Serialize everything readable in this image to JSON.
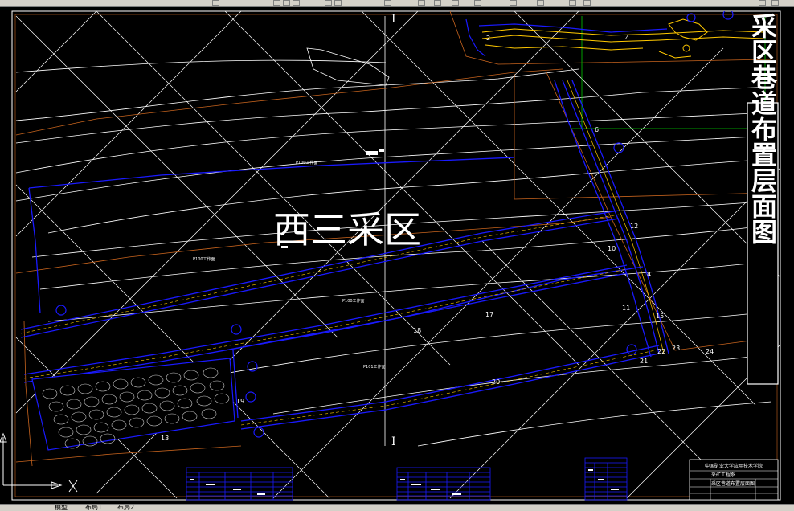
{
  "drawing": {
    "main_label": "西三采区",
    "vertical_title": "采区巷道布置层面图",
    "section_marks": [
      "I",
      "I"
    ],
    "workface_labels": [
      "P100工作面",
      "P100工作面",
      "P100工作面",
      "P101工作面"
    ],
    "point_labels": [
      "2",
      "4",
      "6",
      "10",
      "11",
      "12",
      "13",
      "14",
      "15",
      "17",
      "18",
      "19",
      "20",
      "21",
      "22",
      "23",
      "24"
    ]
  },
  "title_block": {
    "school": "中国矿业大学应用技术学院",
    "dept": "采矿工程系",
    "drawing_name": "采区巷道布置层面图"
  },
  "tabs": {
    "model": "模型",
    "layout1": "布局1",
    "layout2": "布局2"
  },
  "colors": {
    "background": "#000000",
    "roadway_blue": "#1a1aff",
    "contour_white": "#ffffff",
    "boundary_orange": "#c8641e",
    "survey_green": "#00c800",
    "yellow": "#ffc800"
  }
}
